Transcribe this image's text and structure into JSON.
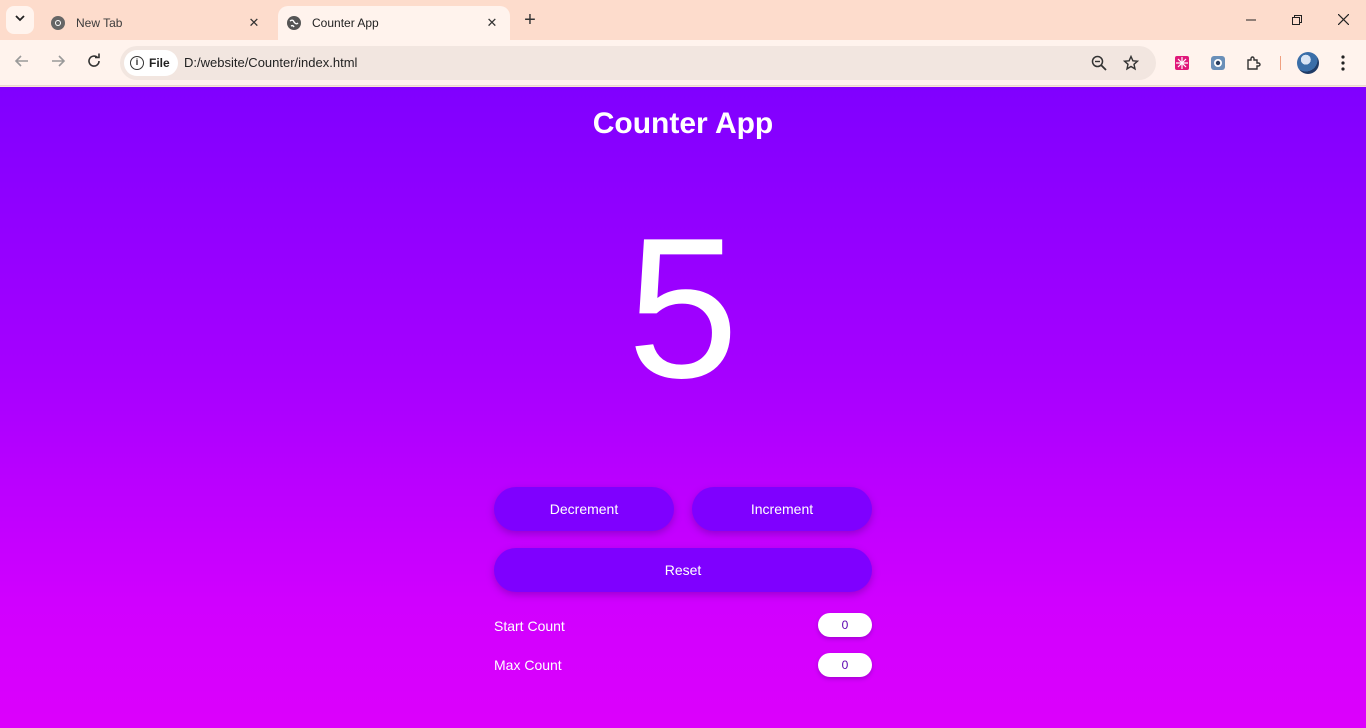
{
  "browser": {
    "tabs": [
      {
        "title": "New Tab"
      },
      {
        "title": "Counter App"
      }
    ],
    "site_chip_label": "File",
    "url": "D:/website/Counter/index.html"
  },
  "app": {
    "title": "Counter App",
    "count": "5",
    "decrement_label": "Decrement",
    "increment_label": "Increment",
    "reset_label": "Reset",
    "start_count_label": "Start Count",
    "start_count_value": "0",
    "max_count_label": "Max Count",
    "max_count_value": "0"
  },
  "colors": {
    "gradient_top": "#8000ff",
    "gradient_bottom": "#dc00fc",
    "button": "#7f00ff",
    "tabstrip": "#fddccc",
    "toolbar": "#fff3ed"
  },
  "icons": [
    "tab-search-icon",
    "chrome-icon",
    "globe-icon",
    "close-icon",
    "plus-icon",
    "minimize-icon",
    "restore-icon",
    "window-close-icon",
    "back-arrow-icon",
    "forward-arrow-icon",
    "reload-icon",
    "info-icon",
    "zoom-out-icon",
    "star-icon",
    "extension-grid-icon",
    "extension-camera-icon",
    "puzzle-icon",
    "profile-avatar",
    "kebab-menu-icon"
  ]
}
